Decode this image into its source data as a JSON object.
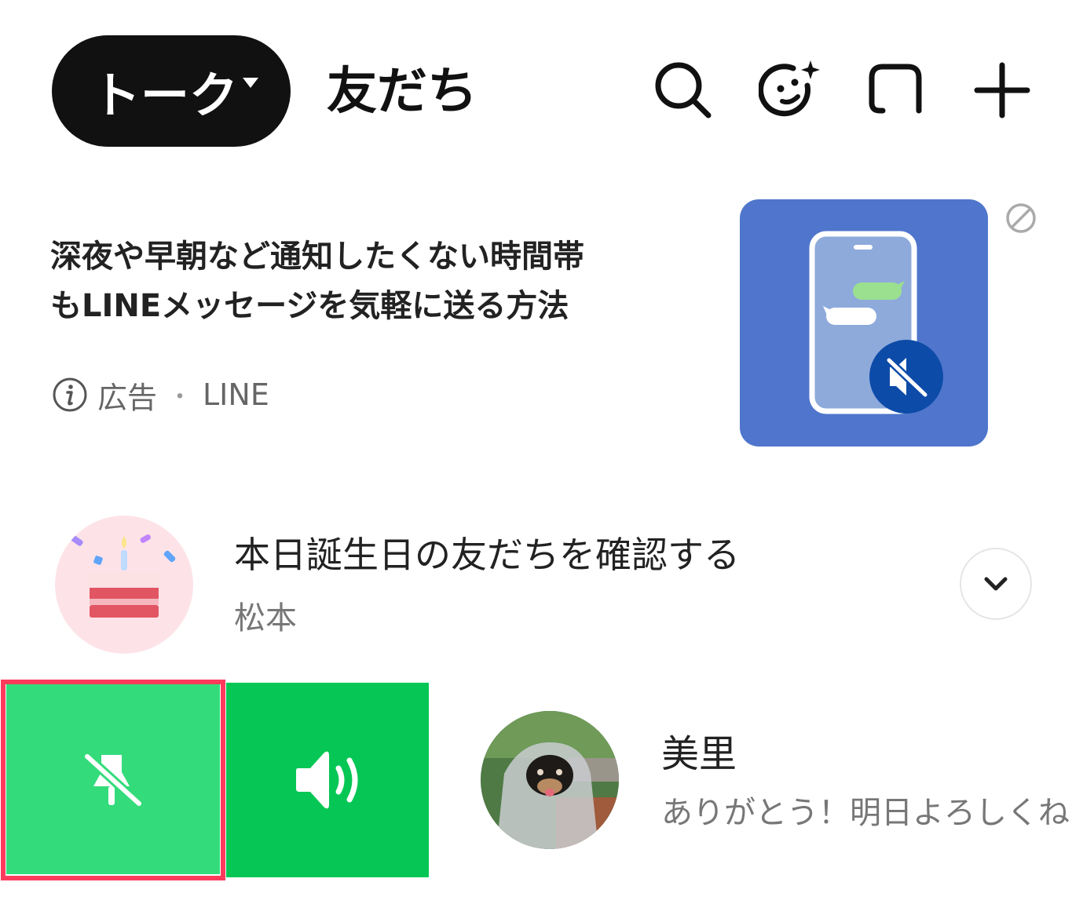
{
  "header": {
    "tabs": [
      {
        "label": "トーク",
        "active": true
      },
      {
        "label": "友だち",
        "active": false
      }
    ],
    "icons": [
      "search-icon",
      "sticker-face-icon",
      "chat-room-icon",
      "add-icon"
    ]
  },
  "ad": {
    "title_line1": "深夜や早朝など通知したくない時間帯",
    "title_line2": "もLINEメッセージを気軽に送る方法",
    "label": "広告",
    "separator": "・",
    "sponsor": "LINE",
    "image_color": "#4f76cc"
  },
  "birthday": {
    "title": "本日誕生日の友だちを確認する",
    "name": "松本"
  },
  "swipe_actions": {
    "notification_color": "#34db7b",
    "sound_color": "#06c755",
    "highlight_color": "#ff3b5c"
  },
  "chat": {
    "name": "美里",
    "last_message": "ありがとう！明日よろしくね"
  }
}
